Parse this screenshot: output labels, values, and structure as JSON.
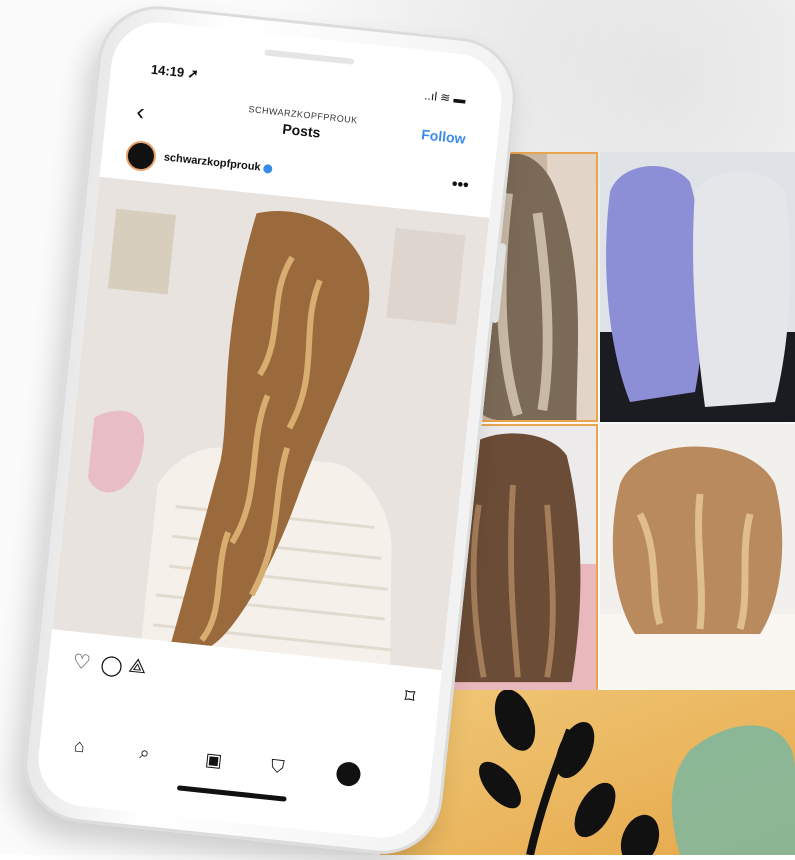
{
  "status_bar": {
    "time": "14:19",
    "location_glyph": "➚",
    "icons": "..ıl ≋ ▬"
  },
  "nav": {
    "back_glyph": "‹",
    "handle": "SCHWARZKOPFPROUK",
    "title": "Posts",
    "follow": "Follow"
  },
  "post": {
    "username": "schwarzkopfprouk",
    "more_glyph": "•••"
  },
  "actions": {
    "like": "♡",
    "comment": "◯",
    "share": "⟁",
    "save": "⌑"
  },
  "tabbar": {
    "home": "⌂",
    "search": "⌕",
    "reels": "▣",
    "shop": "⛉"
  },
  "colors": {
    "follow_blue": "#3a8be8",
    "avatar_ring": "#e9a26b",
    "grid_border": "#e8a44e"
  },
  "icons": [
    "home-icon",
    "search-icon",
    "reels-icon",
    "shop-icon",
    "heart-icon",
    "comment-icon",
    "share-icon",
    "bookmark-icon",
    "verified-icon",
    "back-icon"
  ]
}
